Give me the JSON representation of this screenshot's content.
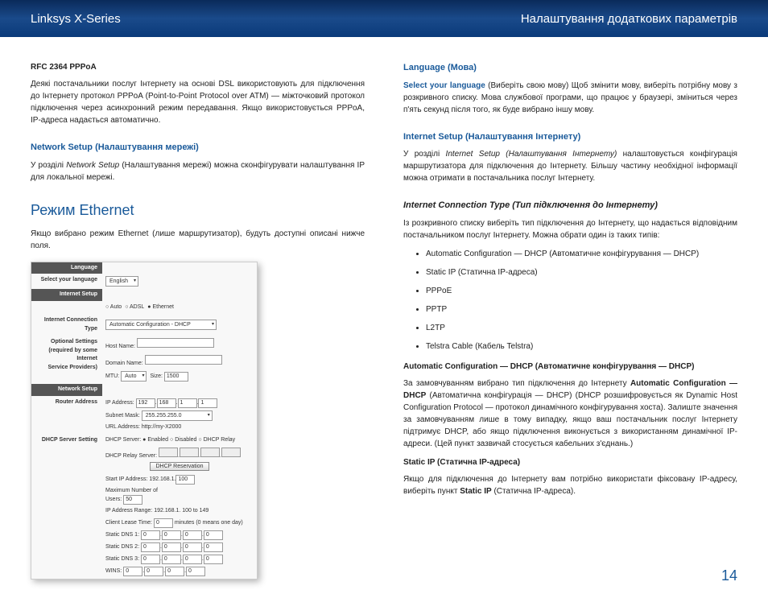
{
  "header": {
    "left": "Linksys X-Series",
    "right": "Налаштування додаткових параметрів"
  },
  "left": {
    "rfc_title": "RFC 2364 PPPoA",
    "rfc_text": "Деякі постачальники послуг Інтернету на основі DSL використовують для підключення до Інтернету протокол PPPoA (Point-to-Point Protocol over ATM) — міжточковий протокол підключення через асинхронний режим передавання. Якщо використовується PPPoA, IP-адреса надається автоматично.",
    "net_title": "Network Setup (Налаштування мережі)",
    "net_text_pre": "У розділі ",
    "net_text_italic": "Network Setup",
    "net_text_post": " (Налаштування мережі) можна сконфігурувати налаштування IP для локальної мережі.",
    "eth_title": "Режим Ethernet",
    "eth_text": "Якщо вибрано режим Ethernet (лише маршрутизатор), будуть доступні описані нижче поля.",
    "ss": {
      "language_hdr": "Language",
      "select_lang": "Select your language",
      "english": "English",
      "internet_setup_hdr": "Internet Setup",
      "auto": "Auto",
      "adsl": "ADSL",
      "ethernet": "Ethernet",
      "ict": "Internet Connection Type",
      "ict_val": "Automatic Configuration - DHCP",
      "opt": "Optional Settings\n(required by some Internet\nService Providers)",
      "hostname": "Host Name:",
      "domainname": "Domain Name:",
      "mtu": "MTU:",
      "mtu_auto": "Auto",
      "size": "Size:",
      "size_val": "1500",
      "network_setup_hdr": "Network Setup",
      "router_addr": "Router Address",
      "ip_addr": "IP Address:",
      "ip1": "192",
      "ip2": "168",
      "ip3": "1",
      "ip4": "1",
      "subnet": "Subnet Mask:",
      "subnet_val": "255.255.255.0",
      "url": "URL Address:",
      "url_val": "http://my-X2000",
      "dhcp_setting": "DHCP Server Setting",
      "dhcp_server": "DHCP Server:",
      "enabled": "Enabled",
      "disabled": "Disabled",
      "dhcp_relay": "DHCP Relay",
      "dhcp_relay_srv": "DHCP Relay Server:",
      "dhcp_res": "DHCP Reservation",
      "start_ip": "Start IP Address:",
      "start_ip_pre": "192.168.1.",
      "start_ip_val": "100",
      "max_users": "Maximum Number of\nUsers:",
      "max_users_val": "50",
      "ip_range": "IP Address Range:",
      "ip_range_val": "192.168.1. 100 to 149",
      "lease": "Client Lease Time:",
      "lease_val": "0",
      "lease_note": "minutes (0 means one day)",
      "dns1": "Static DNS 1:",
      "dns2": "Static DNS 2:",
      "dns3": "Static DNS 3:",
      "wins": "WINS:",
      "zero": "0"
    }
  },
  "right": {
    "lang_title": "Language (Мова)",
    "lang_bold": "Select your language",
    "lang_text": " (Виберіть свою мову) Щоб змінити мову, виберіть потрібну мову з розкривного списку. Мова службової програми, що працює у браузері, зміниться через п'ять секунд після того, як буде вибрано іншу мову.",
    "inet_title": "Internet Setup (Налаштування Інтернету)",
    "inet_text_pre": "У розділі ",
    "inet_text_italic": "Internet Setup (Налаштування Інтернету)",
    "inet_text_post": " налаштовується конфігурація маршрутизатора для підключення до Інтернету. Більшу частину необхідної інформації можна отримати в постачальника послуг Інтернету.",
    "ict_title": "Internet Connection Type (Тип підключення до Інтернету)",
    "ict_text": "Із розкривного списку виберіть тип підключення до Інтернету, що надається відповідним постачальником послуг Інтернету. Можна обрати один із таких типів:",
    "list": [
      "Automatic Configuration — DHCP (Автоматичне конфігурування — DHCP)",
      "Static IP (Статична IP-адреса)",
      "PPPoE",
      "PPTP",
      "L2TP",
      "Telstra Cable (Кабель Telstra)"
    ],
    "auto_title": "Automatic Configuration — DHCP (Автоматичне конфігурування — DHCP)",
    "auto_text_pre": "За замовчуванням вибрано тип підключення до Інтернету ",
    "auto_text_bold": "Automatic Configuration — DHCP",
    "auto_text_post": " (Автоматична конфігурація — DHCP) (DHCP розшифровується як Dynamic Host Configuration Protocol — протокол динамічного конфігурування хоста). Залиште значення за замовчуванням лише в тому випадку, якщо ваш постачальник послуг Інтернету підтримує DHCP, або якщо підключення виконується з використанням динамічної IP-адреси. (Цей пункт зазвичай стосується кабельних з'єднань.)",
    "static_title": "Static IP (Статична IP-адреса)",
    "static_text_pre": "Якщо для підключення до Інтернету вам потрібно використати фіксовану IP-адресу, виберіть пункт ",
    "static_text_bold": "Static IP",
    "static_text_post": " (Статична IP-адреса)."
  },
  "page": "14"
}
